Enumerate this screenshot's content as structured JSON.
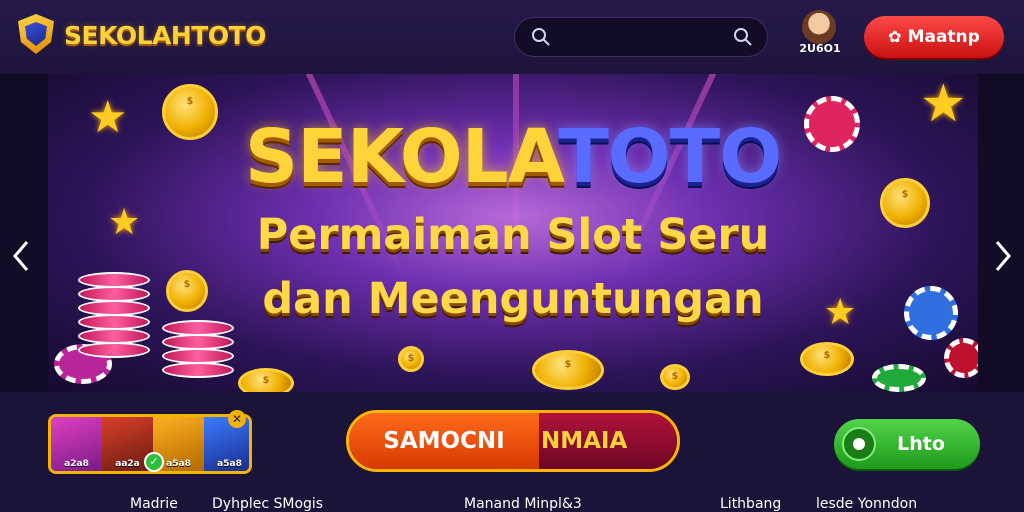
{
  "header": {
    "brand": "SEKOLAHTOTO",
    "search_placeholder": "",
    "user_id": "2U6O1",
    "login_label": "Maatnp"
  },
  "banner": {
    "title_gold": "SEKOLA",
    "title_blue": "TOTO",
    "subtitle_line1": "Permaiman Slot Seru",
    "subtitle_line2": "dan Meenguntungan",
    "prev_icon": "chevron-left-icon",
    "next_icon": "chevron-right-icon"
  },
  "games": {
    "thumbs": [
      "a2a8",
      "aa2a",
      "a5a8",
      "a5a8"
    ],
    "badge": "✕"
  },
  "cta": {
    "left_label": "SAMOCNI",
    "right_label": "NMAIA"
  },
  "secondary": {
    "label": "Lhto"
  },
  "footer": {
    "links": [
      "Madrie",
      "Dyhplec SMogis",
      "Manand Minpl&3",
      "Lithbang",
      "lesde Yonndon"
    ]
  },
  "colors": {
    "accent_gold": "#ffd23a",
    "login_red": "#e02020",
    "cta_orange": "#ff6a1a",
    "cta_maroon": "#8a0a2c",
    "secondary_green": "#3bbf34",
    "background": "#1b1338"
  }
}
